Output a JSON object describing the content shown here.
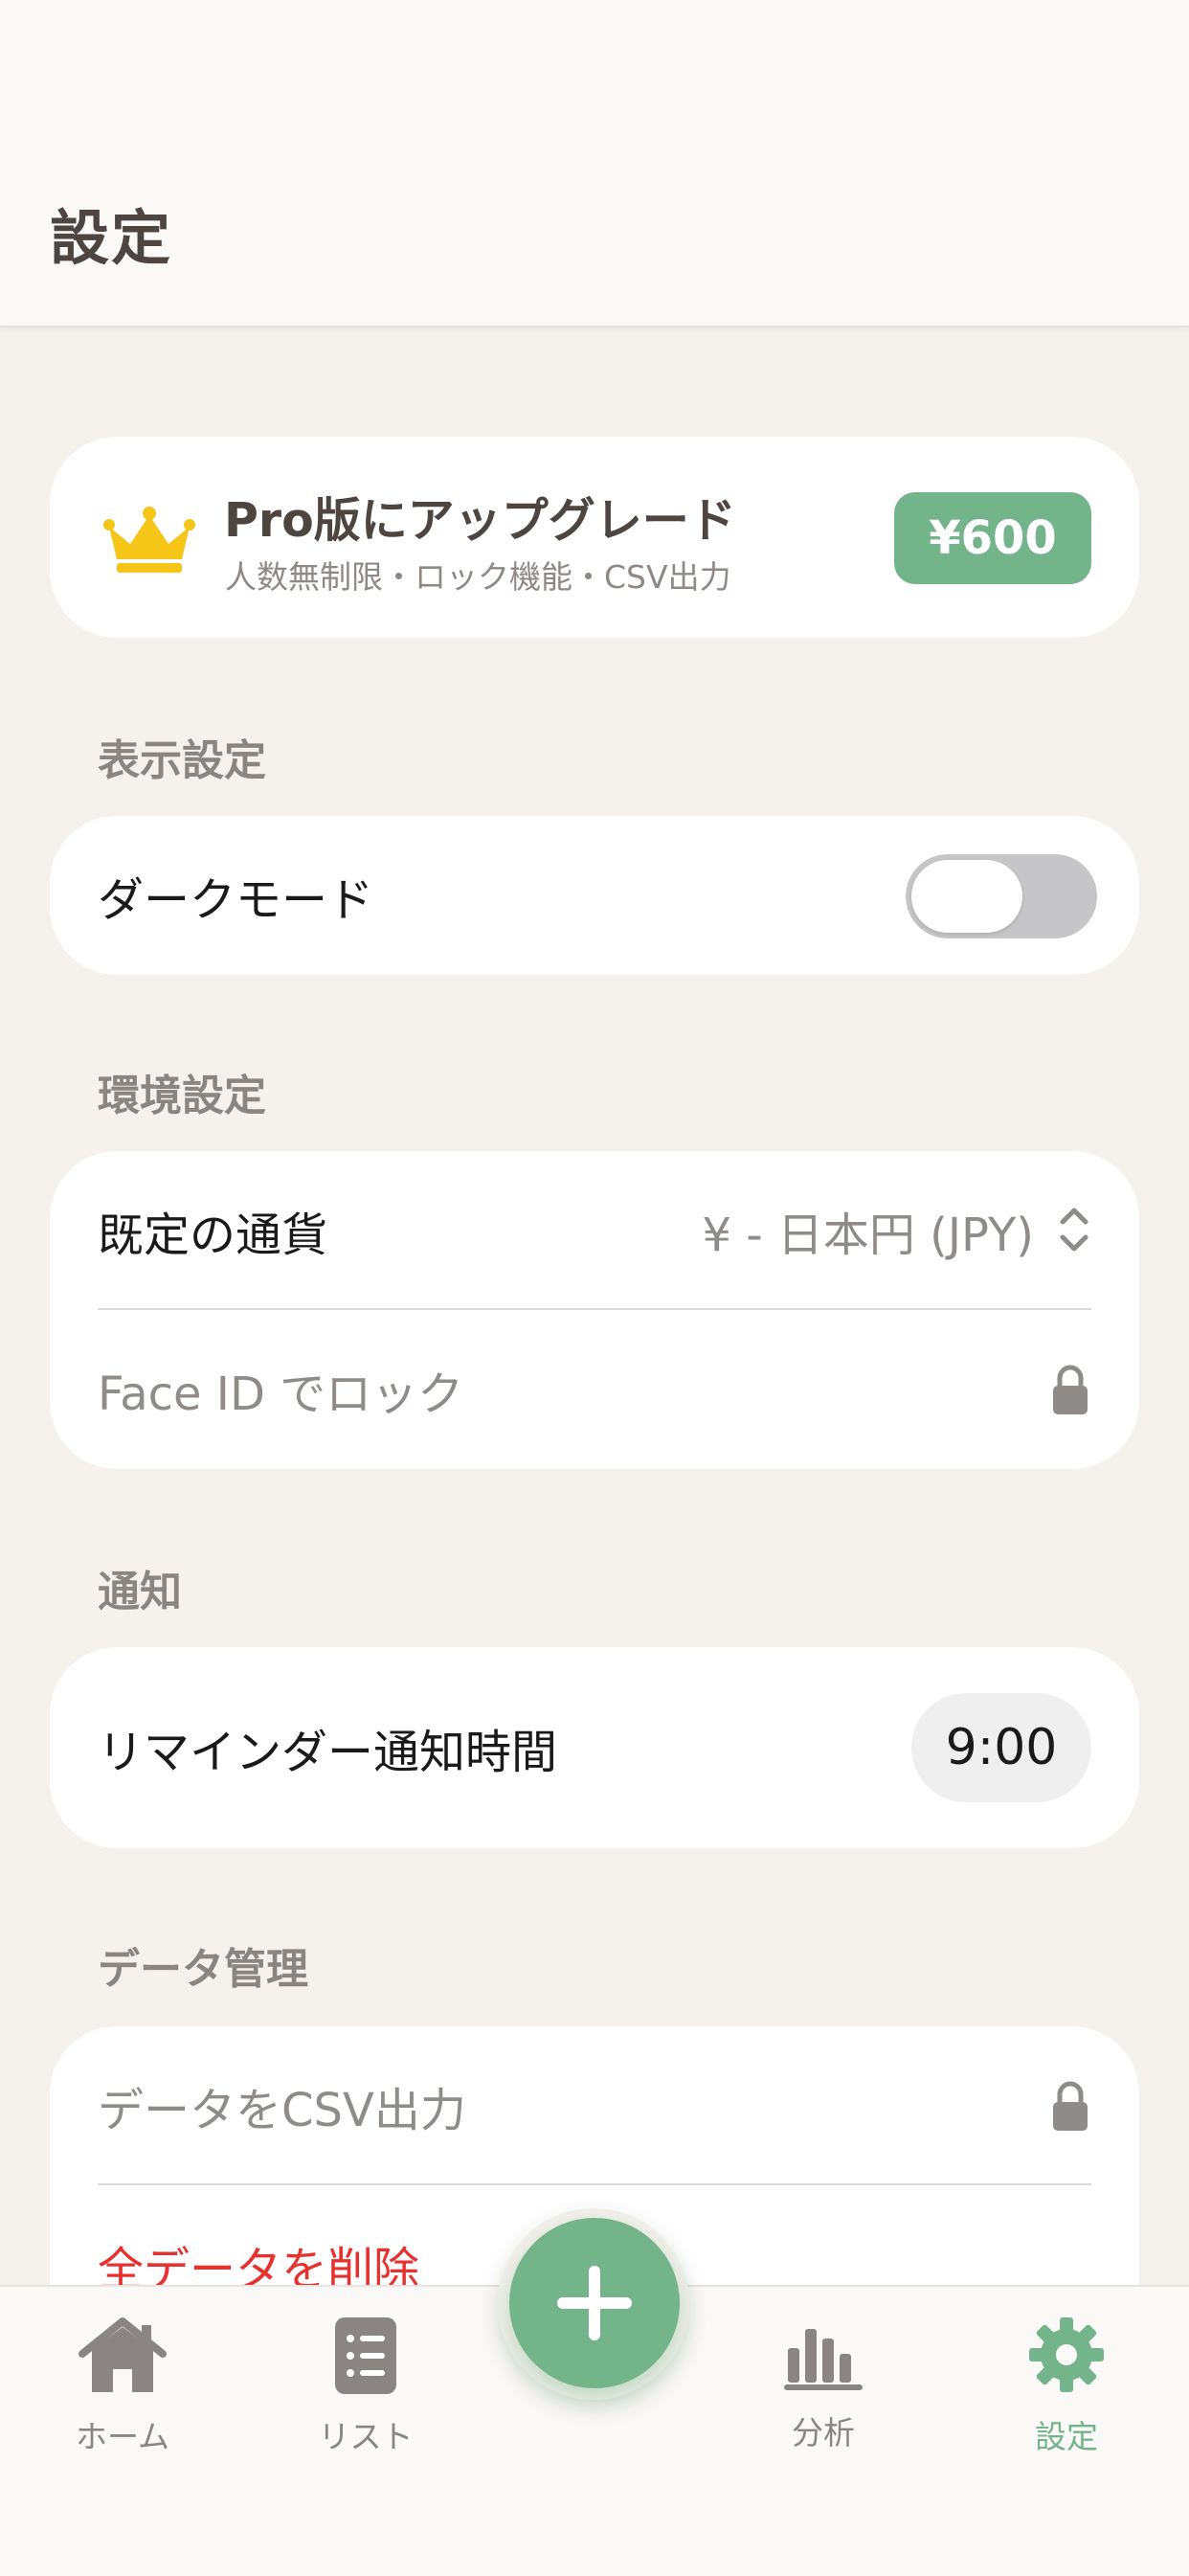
{
  "header": {
    "title": "設定"
  },
  "pro_banner": {
    "title": "Pro版にアップグレード",
    "subtitle": "人数無制限・ロック機能・CSV出力",
    "price": "¥600",
    "icon": "crown-icon"
  },
  "sections": {
    "display": {
      "header": "表示設定",
      "dark_mode_label": "ダークモード",
      "dark_mode_on": false
    },
    "environment": {
      "header": "環境設定",
      "currency_label": "既定の通貨",
      "currency_value": "¥ - 日本円 (JPY)",
      "faceid_label": "Face ID でロック"
    },
    "notification": {
      "header": "通知",
      "reminder_label": "リマインダー通知時間",
      "reminder_time": "9:00"
    },
    "data": {
      "header": "データ管理",
      "csv_label": "データをCSV出力",
      "delete_label": "全データを削除"
    }
  },
  "tabbar": {
    "home": "ホーム",
    "list": "リスト",
    "analytics": "分析",
    "settings": "設定",
    "active": "settings"
  },
  "colors": {
    "accent": "#74b48a",
    "danger": "#e5322e",
    "background": "#f5f1ed",
    "crown": "#f5c518"
  }
}
